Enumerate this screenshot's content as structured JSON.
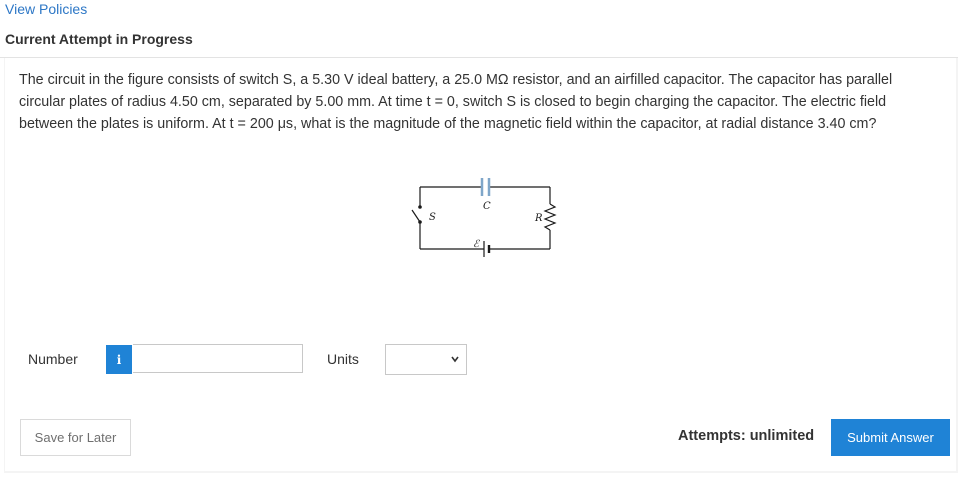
{
  "header": {
    "view_policies": "View Policies",
    "attempt_status": "Current Attempt in Progress"
  },
  "question": {
    "text": "The circuit in the figure consists of switch S, a 5.30 V ideal battery, a 25.0 MΩ resistor, and an airfilled capacitor. The capacitor has parallel circular plates of radius 4.50 cm, separated by 5.00 mm. At time t = 0, switch S is closed to begin charging the capacitor. The electric field between the plates is uniform. At t = 200 μs, what is the magnitude of the magnetic field within the capacitor, at radial distance 3.40 cm?"
  },
  "figure": {
    "label_capacitor": "C",
    "label_switch": "S",
    "label_resistor": "R",
    "label_emf": "ℰ",
    "wire_color": "#1a1a1a",
    "capacitor_color": "#7fa6c9"
  },
  "answer": {
    "number_label": "Number",
    "info_icon_glyph": "i",
    "number_value": "",
    "number_placeholder": "",
    "units_label": "Units",
    "units_selected": ""
  },
  "footer": {
    "save_label": "Save for Later",
    "attempts_text": "Attempts: unlimited",
    "submit_label": "Submit Answer"
  },
  "colors": {
    "link": "#2d77c6",
    "primary_button": "#1f83d6",
    "panel_background": "#f4f4f4"
  }
}
